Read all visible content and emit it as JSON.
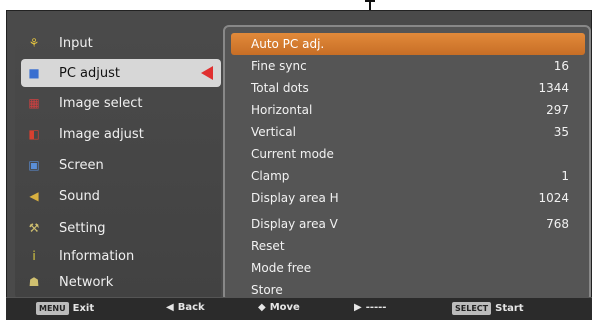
{
  "menu": [
    {
      "label": "Input",
      "icon": "input-icon",
      "glyph": "⚘",
      "color": "#e0c040"
    },
    {
      "label": "PC adjust",
      "icon": "pc-adjust-icon",
      "glyph": "■",
      "color": "#3a6fd0",
      "active": true
    },
    {
      "label": "Image select",
      "icon": "image-select-icon",
      "glyph": "▦",
      "color": "#d04040"
    },
    {
      "label": "Image adjust",
      "icon": "image-adjust-icon",
      "glyph": "◧",
      "color": "#d84030"
    },
    {
      "label": "Screen",
      "icon": "screen-icon",
      "glyph": "▣",
      "color": "#5a8fd8"
    },
    {
      "label": "Sound",
      "icon": "sound-icon",
      "glyph": "◀",
      "color": "#d8b040"
    },
    {
      "label": "Setting",
      "icon": "setting-icon",
      "glyph": "⚒",
      "color": "#d0c070"
    },
    {
      "label": "Information",
      "icon": "information-icon",
      "glyph": "i",
      "color": "#e0d040"
    },
    {
      "label": "Network",
      "icon": "network-icon",
      "glyph": "☗",
      "color": "#d0c070"
    }
  ],
  "submenu": [
    {
      "label": "Auto PC adj.",
      "value": "",
      "highlight": true
    },
    {
      "label": "Fine sync",
      "value": "16"
    },
    {
      "label": "Total dots",
      "value": "1344"
    },
    {
      "label": "Horizontal",
      "value": "297"
    },
    {
      "label": "Vertical",
      "value": "35"
    },
    {
      "label": "Current mode",
      "value": ""
    },
    {
      "label": "Clamp",
      "value": "1"
    },
    {
      "label": "Display area H",
      "value": "1024"
    },
    {
      "label": "Display area V",
      "value": "768"
    },
    {
      "label": "Reset",
      "value": ""
    },
    {
      "label": "Mode free",
      "value": ""
    },
    {
      "label": "Store",
      "value": ""
    }
  ],
  "footer": {
    "exit_key": "MENU",
    "exit_label": "Exit",
    "back_glyph": "◀",
    "back_label": "Back",
    "move_glyph": "◆",
    "move_label": "Move",
    "next_glyph": "▶",
    "next_label": "-----",
    "start_key": "SELECT",
    "start_label": "Start"
  },
  "colors": {
    "highlight": "#d87a30",
    "selector": "#e03030"
  }
}
